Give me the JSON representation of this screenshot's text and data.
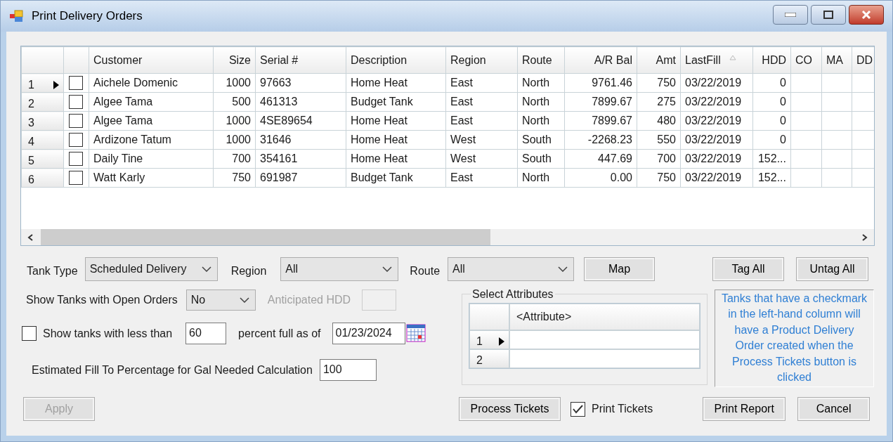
{
  "window": {
    "title": "Print Delivery Orders"
  },
  "grid": {
    "columns": [
      {
        "label": "Customer",
        "kind": "text",
        "sorted": false
      },
      {
        "label": "Size",
        "kind": "number",
        "sorted": false
      },
      {
        "label": "Serial #",
        "kind": "text",
        "sorted": false
      },
      {
        "label": "Description",
        "kind": "text",
        "sorted": false
      },
      {
        "label": "Region",
        "kind": "text",
        "sorted": false
      },
      {
        "label": "Route",
        "kind": "text",
        "sorted": false
      },
      {
        "label": "A/R Bal",
        "kind": "number",
        "sorted": false
      },
      {
        "label": "Amt",
        "kind": "number",
        "sorted": false
      },
      {
        "label": "LastFill",
        "kind": "text",
        "sorted": true
      },
      {
        "label": "HDD",
        "kind": "number",
        "sorted": false
      },
      {
        "label": "CO",
        "kind": "text",
        "sorted": false
      },
      {
        "label": "MA",
        "kind": "text",
        "sorted": false
      },
      {
        "label": "DD",
        "kind": "text",
        "sorted": false
      }
    ],
    "rows": [
      {
        "number": "1",
        "selected": true,
        "checked": false,
        "cells": [
          "Aichele Domenic",
          "1000",
          "97663",
          "Home Heat",
          "East",
          "North",
          "9761.46",
          "750",
          "03/22/2019",
          "0"
        ]
      },
      {
        "number": "2",
        "selected": false,
        "checked": false,
        "cells": [
          "Algee Tama",
          "500",
          "461313",
          "Budget Tank",
          "East",
          "North",
          "7899.67",
          "275",
          "03/22/2019",
          "0"
        ]
      },
      {
        "number": "3",
        "selected": false,
        "checked": false,
        "cells": [
          "Algee Tama",
          "1000",
          "4SE89654",
          "Home Heat",
          "East",
          "North",
          "7899.67",
          "480",
          "03/22/2019",
          "0"
        ]
      },
      {
        "number": "4",
        "selected": false,
        "checked": false,
        "cells": [
          "Ardizone Tatum",
          "1000",
          "31646",
          "Home Heat",
          "West",
          "South",
          "-2268.23",
          "550",
          "03/22/2019",
          "0"
        ]
      },
      {
        "number": "5",
        "selected": false,
        "checked": false,
        "cells": [
          "Daily Tine",
          "700",
          "354161",
          "Home Heat",
          "West",
          "South",
          "447.69",
          "700",
          "03/22/2019",
          "152..."
        ]
      },
      {
        "number": "6",
        "selected": false,
        "checked": false,
        "cells": [
          "Watt Karly",
          "750",
          "691987",
          "Budget Tank",
          "East",
          "North",
          "0.00",
          "750",
          "03/22/2019",
          "152..."
        ]
      }
    ]
  },
  "filters": {
    "tank_type": {
      "label": "Tank Type",
      "value": "Scheduled Delivery"
    },
    "region": {
      "label": "Region",
      "value": "All"
    },
    "route": {
      "label": "Route",
      "value": "All"
    },
    "open_orders": {
      "label": "Show Tanks with Open Orders",
      "value": "No"
    },
    "anticipated_hdd": {
      "label": "Anticipated HDD",
      "disabled": true
    },
    "less_than": {
      "label": "Show tanks with less than",
      "checked": false,
      "value": "60"
    },
    "percent_full": {
      "label": "percent full as of",
      "value": "01/23/2024"
    },
    "estimated_fill": {
      "label": "Estimated Fill To Percentage for Gal Needed Calculation",
      "value": "100"
    }
  },
  "top_buttons": [
    {
      "label": "Map",
      "disabled": false
    },
    {
      "label": "Tag All",
      "disabled": false
    },
    {
      "label": "Untag All",
      "disabled": false
    }
  ],
  "attributes": {
    "title": "Select Attributes",
    "column": "<Attribute>",
    "rows": [
      {
        "number": "1",
        "selected": true
      },
      {
        "number": "2",
        "selected": false
      }
    ]
  },
  "info": "Tanks that have a checkmark in the left-hand column will have a Product Delivery Order created when the Process Tickets button is clicked",
  "apply_button": {
    "label": "Apply",
    "disabled": true
  },
  "process_button": {
    "label": "Process Tickets",
    "disabled": false
  },
  "print_tickets": {
    "label": "Print Tickets",
    "checked": true
  },
  "bottom_buttons": [
    {
      "label": "Print Report",
      "disabled": false
    },
    {
      "label": "Cancel",
      "disabled": false
    }
  ]
}
